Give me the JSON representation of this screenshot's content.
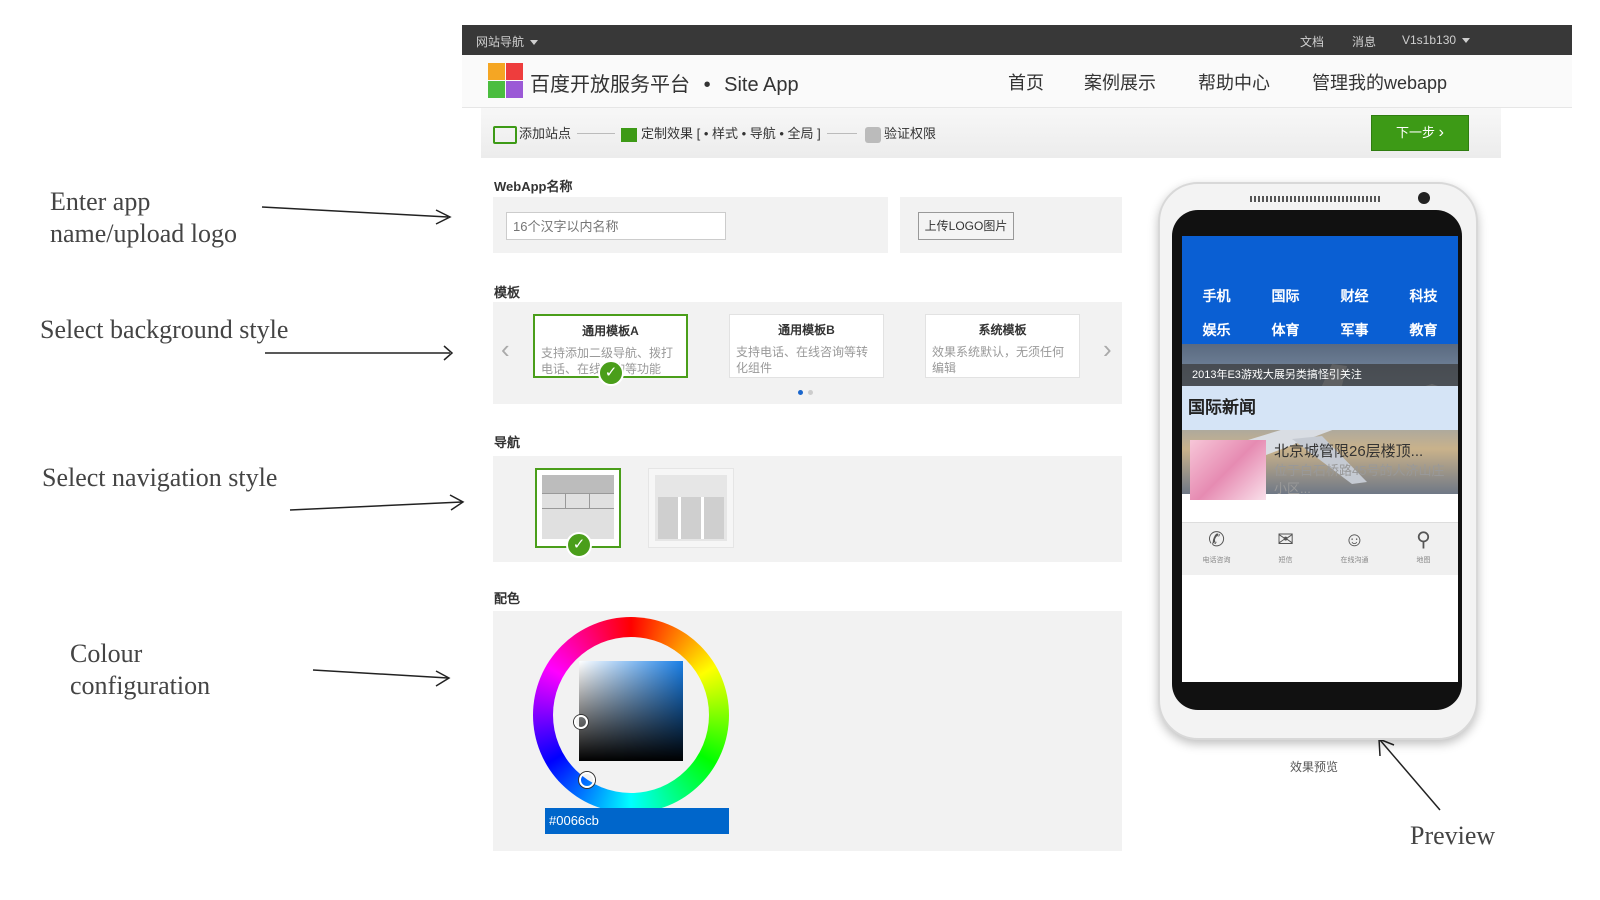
{
  "annotations": {
    "logo": [
      "Enter app",
      "name/upload logo"
    ],
    "background": "Select background style",
    "navigation": "Select navigation style",
    "colour": [
      "Colour",
      "configuration"
    ],
    "preview": "Preview"
  },
  "topbar": {
    "site_nav": "网站导航",
    "docs": "文档",
    "messages": "消息",
    "user": "V1s1b130"
  },
  "header": {
    "brand": "百度开放服务平台",
    "separator": "•",
    "product": "Site App",
    "nav": [
      "首页",
      "案例展示",
      "帮助中心",
      "管理我的webapp"
    ]
  },
  "steps": {
    "add_site": "添加站点",
    "customize": "定制效果 [ • 样式 • 导航 • 全局 ]",
    "verify": "验证权限",
    "next": "下一步"
  },
  "form": {
    "name_label": "WebApp名称",
    "name_placeholder": "16个汉字以内名称",
    "upload_logo": "上传LOGO图片",
    "template_label": "模板",
    "templates": [
      {
        "title": "通用模板A",
        "desc": "支持添加二级导航、拨打电话、在线咨询等功能"
      },
      {
        "title": "通用模板B",
        "desc": "支持电话、在线咨询等转化组件"
      },
      {
        "title": "系统模板",
        "desc": "效果系统默认，无须任何编辑"
      }
    ],
    "nav_label": "导航",
    "color_label": "配色",
    "color_value": "#0066cb"
  },
  "preview": {
    "categories": [
      "手机",
      "国际",
      "财经",
      "科技",
      "娱乐",
      "体育",
      "军事",
      "教育"
    ],
    "caption": "2013年E3游戏大展另类搞怪引关注",
    "section": "国际新闻",
    "news_title": "北京城管限26层楼顶...",
    "news_desc": "位于白石桥路45号的人济山庄小区...",
    "tabs": [
      {
        "icon": "phone-icon",
        "label": "电话咨询"
      },
      {
        "icon": "mail-icon",
        "label": "短信"
      },
      {
        "icon": "chat-icon",
        "label": "在线沟通"
      },
      {
        "icon": "map-pin-icon",
        "label": "地图"
      }
    ],
    "label": "效果预览"
  },
  "colors": {
    "accent_green": "#3d9a16",
    "brand_blue": "#0a5fd3",
    "selected_color": "#0066cb"
  }
}
